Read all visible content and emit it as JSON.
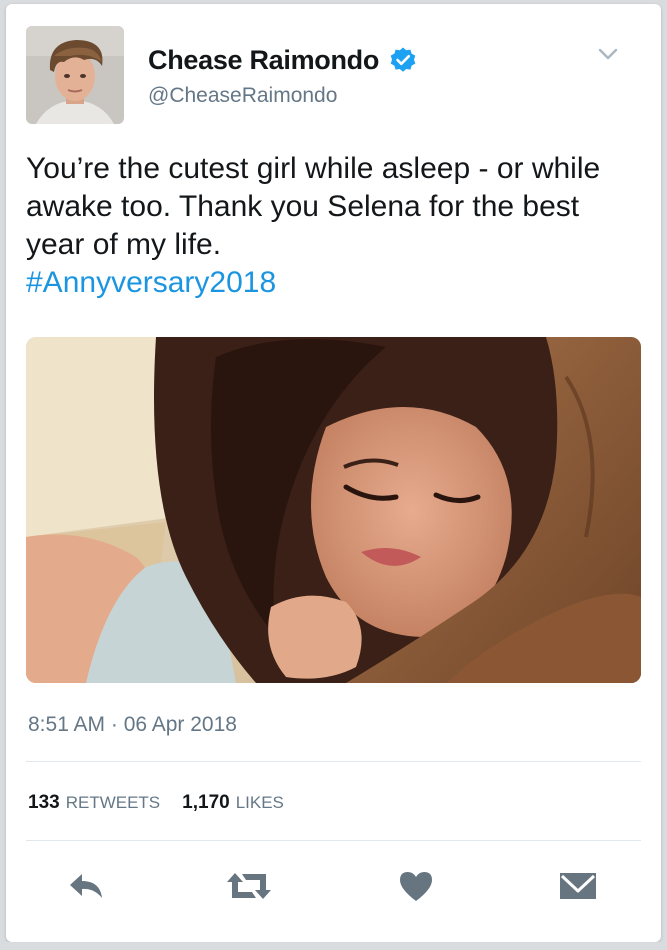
{
  "author": {
    "name": "Chease Raimondo",
    "handle": "@CheaseRaimondo",
    "verified": true
  },
  "tweet": {
    "text_lines": [
      "You’re the cutest girl while asleep - or while",
      "awake too. Thank you Selena for the best",
      "year of my life."
    ],
    "hashtag": "#Annyversary2018",
    "timestamp": "8:51 AM · 06 Apr 2018"
  },
  "stats": {
    "retweets_count": "133",
    "retweets_label": "RETWEETS",
    "likes_count": "1,170",
    "likes_label": "LIKES"
  },
  "icons": {
    "verified": "verified-badge-icon",
    "menu": "chevron-down-icon",
    "reply": "reply-icon",
    "retweet": "retweet-icon",
    "like": "heart-icon",
    "message": "envelope-icon"
  },
  "colors": {
    "link": "#1b95e0",
    "text": "#14171a",
    "muted": "#657786",
    "action_icon": "#66757f",
    "divider": "#e1e8ed"
  }
}
